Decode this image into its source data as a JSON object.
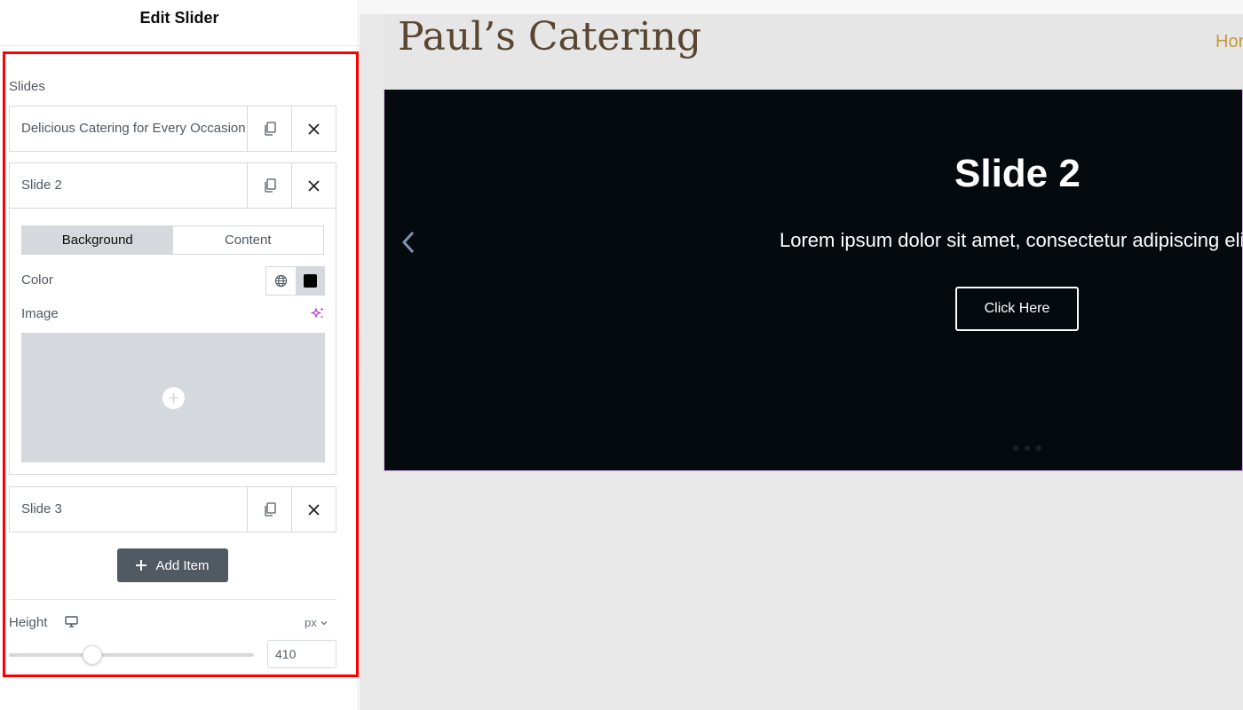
{
  "panel": {
    "title": "Edit Slider",
    "slides_label": "Slides",
    "slides": [
      {
        "title": "Delicious Catering for Every Occasion"
      },
      {
        "title": "Slide 2"
      },
      {
        "title": "Slide 3"
      }
    ],
    "tabs": {
      "background": "Background",
      "content": "Content",
      "active": "Background"
    },
    "color_label": "Color",
    "color_value": "#000000",
    "image_label": "Image",
    "add_item_label": "Add Item",
    "height": {
      "label": "Height",
      "unit": "px",
      "value": "410"
    }
  },
  "preview": {
    "logo": "Paul’s Catering",
    "nav_home": "Hor",
    "slide": {
      "heading": "Slide 2",
      "description": "Lorem ipsum dolor sit amet, consectetur adipiscing eli",
      "button_label": "Click Here"
    }
  },
  "colors": {
    "highlight": "#ff0000",
    "slider_bg": "#050a0f",
    "logo": "#5a4630",
    "nav": "#c19a3f"
  }
}
